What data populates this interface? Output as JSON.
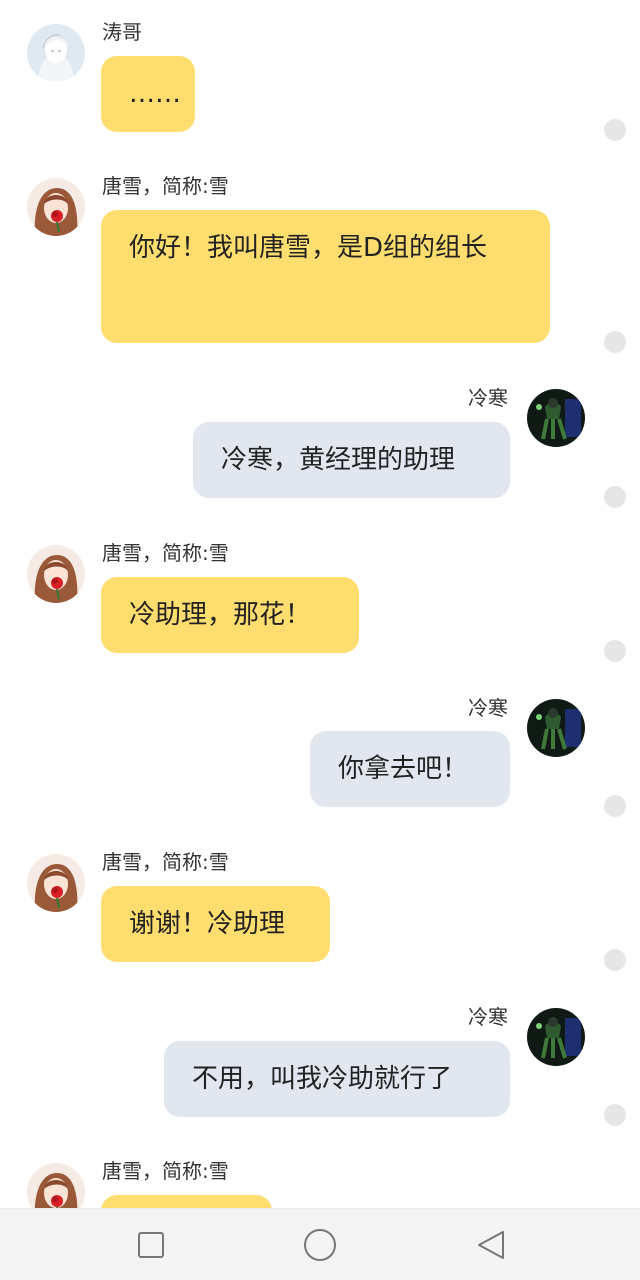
{
  "messages": [
    {
      "side": "left",
      "sender": "涛哥",
      "text": "……",
      "avatar": "boy-avatar-icon"
    },
    {
      "side": "left",
      "sender": "唐雪，简称:雪",
      "text": "你好！我叫唐雪，是D组的组长",
      "avatar": "girl-rose-avatar-icon"
    },
    {
      "side": "right",
      "sender": "冷寒",
      "text": "冷寒，黄经理的助理",
      "avatar": "dark-figure-avatar-icon"
    },
    {
      "side": "left",
      "sender": "唐雪，简称:雪",
      "text": "冷助理，那花！",
      "avatar": "girl-rose-avatar-icon"
    },
    {
      "side": "right",
      "sender": "冷寒",
      "text": "你拿去吧！",
      "avatar": "dark-figure-avatar-icon"
    },
    {
      "side": "left",
      "sender": "唐雪，简称:雪",
      "text": "谢谢！冷助理",
      "avatar": "girl-rose-avatar-icon"
    },
    {
      "side": "right",
      "sender": "冷寒",
      "text": "不用，叫我冷助就行了",
      "avatar": "dark-figure-avatar-icon"
    },
    {
      "side": "left",
      "sender": "唐雪，简称:雪",
      "text": "",
      "avatar": "girl-rose-avatar-icon"
    }
  ],
  "navbar": {
    "buttons": [
      "recent-apps-square-icon",
      "home-circle-icon",
      "back-triangle-icon"
    ]
  },
  "colors": {
    "left_bubble": "#ffdd6e",
    "right_bubble": "#e2e7ef",
    "navbar_bg": "#f4f4f4"
  }
}
